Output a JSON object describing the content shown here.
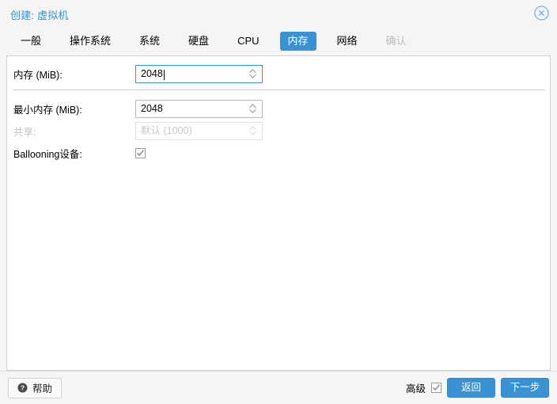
{
  "dialog": {
    "title": "创建: 虚拟机",
    "close_icon": "close-circle-icon"
  },
  "tabs": [
    {
      "label": "一般",
      "state": "normal"
    },
    {
      "label": "操作系统",
      "state": "normal"
    },
    {
      "label": "系统",
      "state": "normal"
    },
    {
      "label": "硬盘",
      "state": "normal"
    },
    {
      "label": "CPU",
      "state": "normal"
    },
    {
      "label": "内存",
      "state": "active"
    },
    {
      "label": "网络",
      "state": "normal"
    },
    {
      "label": "确认",
      "state": "disabled"
    }
  ],
  "form": {
    "memory": {
      "label": "内存 (MiB):",
      "value": "2048",
      "placeholder": "",
      "focused": true,
      "disabled": false
    },
    "min_memory": {
      "label": "最小内存 (MiB):",
      "value": "2048",
      "placeholder": "",
      "focused": false,
      "disabled": false
    },
    "shares": {
      "label": "共享:",
      "value": "默认 (1000)",
      "placeholder": "默认 (1000)",
      "focused": false,
      "disabled": true
    },
    "ballooning": {
      "label": "Ballooning设备:",
      "checked": true,
      "disabled": false
    }
  },
  "footer": {
    "help_label": "帮助",
    "help_icon": "question-circle-icon",
    "advanced_label": "高级",
    "advanced_checked": true,
    "back_label": "返回",
    "next_label": "下一步"
  },
  "colors": {
    "accent": "#3892d4",
    "title_text": "#3892d4",
    "page_bg": "#f5f5f5",
    "content_bg": "#ffffff",
    "disabled_text": "#c3c3c3"
  }
}
